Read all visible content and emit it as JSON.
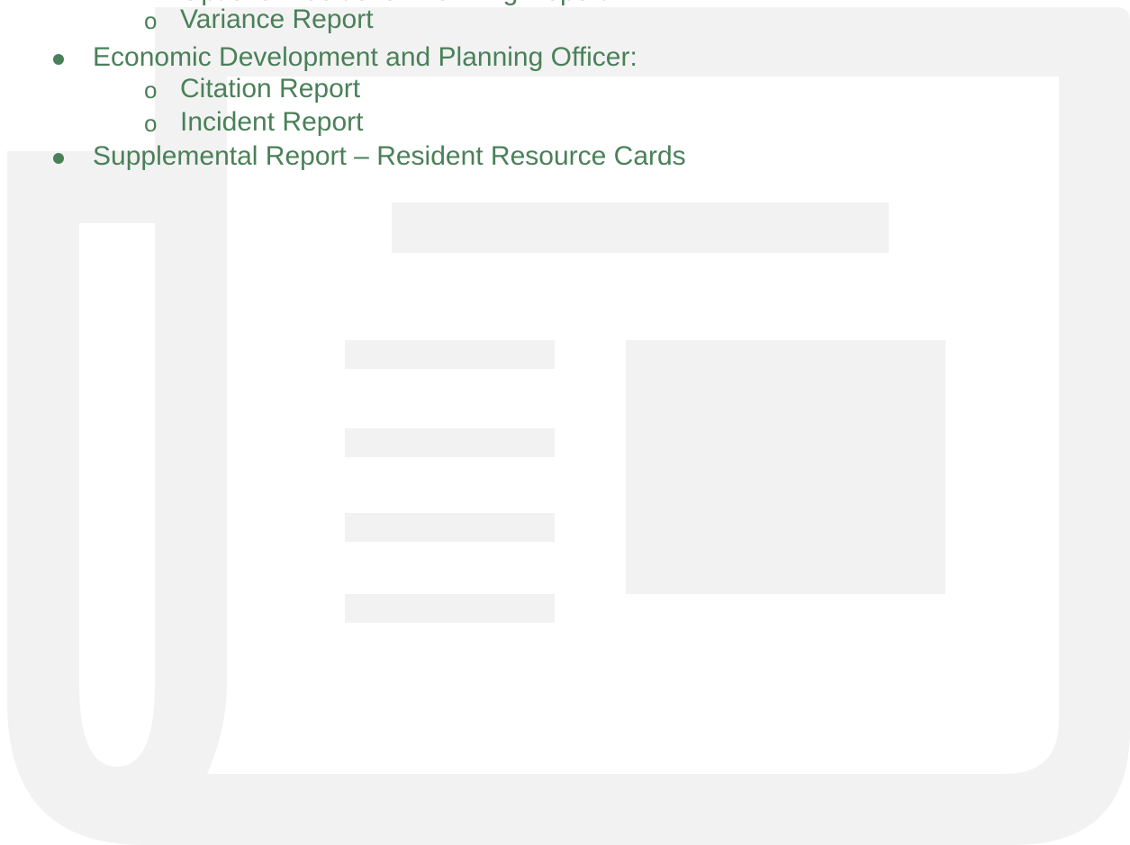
{
  "colors": {
    "text": "#4a8059",
    "watermark": "#f2f2f2"
  },
  "watermark_icon": "newspaper-icon",
  "list": {
    "partial_top_item": "Optional Additional Planning Report",
    "sub_item_1": "Variance Report",
    "item_1": "Economic Development and Planning Officer:",
    "sub_item_2": "Citation Report",
    "sub_item_3": "Incident Report",
    "item_2": "Supplemental Report – Resident Resource Cards",
    "sub_marker": "o"
  }
}
